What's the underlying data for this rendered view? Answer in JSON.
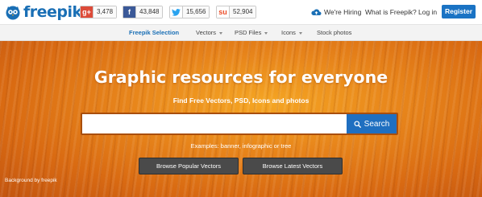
{
  "header": {
    "logo_text": "freepik",
    "social": [
      {
        "icon": "google-plus-icon",
        "glyph": "g+",
        "count": "3,478"
      },
      {
        "icon": "facebook-icon",
        "glyph": "f",
        "count": "43,848"
      },
      {
        "icon": "twitter-icon",
        "glyph": "",
        "count": "15,656"
      },
      {
        "icon": "stumbleupon-icon",
        "glyph": "su",
        "count": "52,904"
      }
    ],
    "hiring_label": "We're Hiring",
    "what_label": "What is Freepik?",
    "login_label": "Log in",
    "register_label": "Register"
  },
  "nav": {
    "items": [
      {
        "label": "Freepik Selection",
        "active": true,
        "dropdown": false
      },
      {
        "label": "Vectors",
        "active": false,
        "dropdown": true
      },
      {
        "label": "PSD Files",
        "active": false,
        "dropdown": true
      },
      {
        "label": "Icons",
        "active": false,
        "dropdown": true
      },
      {
        "label": "Stock photos",
        "active": false,
        "dropdown": false
      }
    ]
  },
  "hero": {
    "title": "Graphic resources for everyone",
    "subtitle": "Find Free Vectors, PSD, Icons and photos",
    "search_value": "",
    "search_placeholder": "",
    "search_button": "Search",
    "examples": "Examples: banner, infographic or tree",
    "btn_popular": "Browse Popular Vectors",
    "btn_latest": "Browse Latest Vectors",
    "credit": "Background by freepik"
  },
  "colors": {
    "brand_blue": "#1a6fb5",
    "register_bg": "#1a73c4",
    "hero_orange": "#e8861b",
    "hero_button": "#4a4a4a"
  }
}
